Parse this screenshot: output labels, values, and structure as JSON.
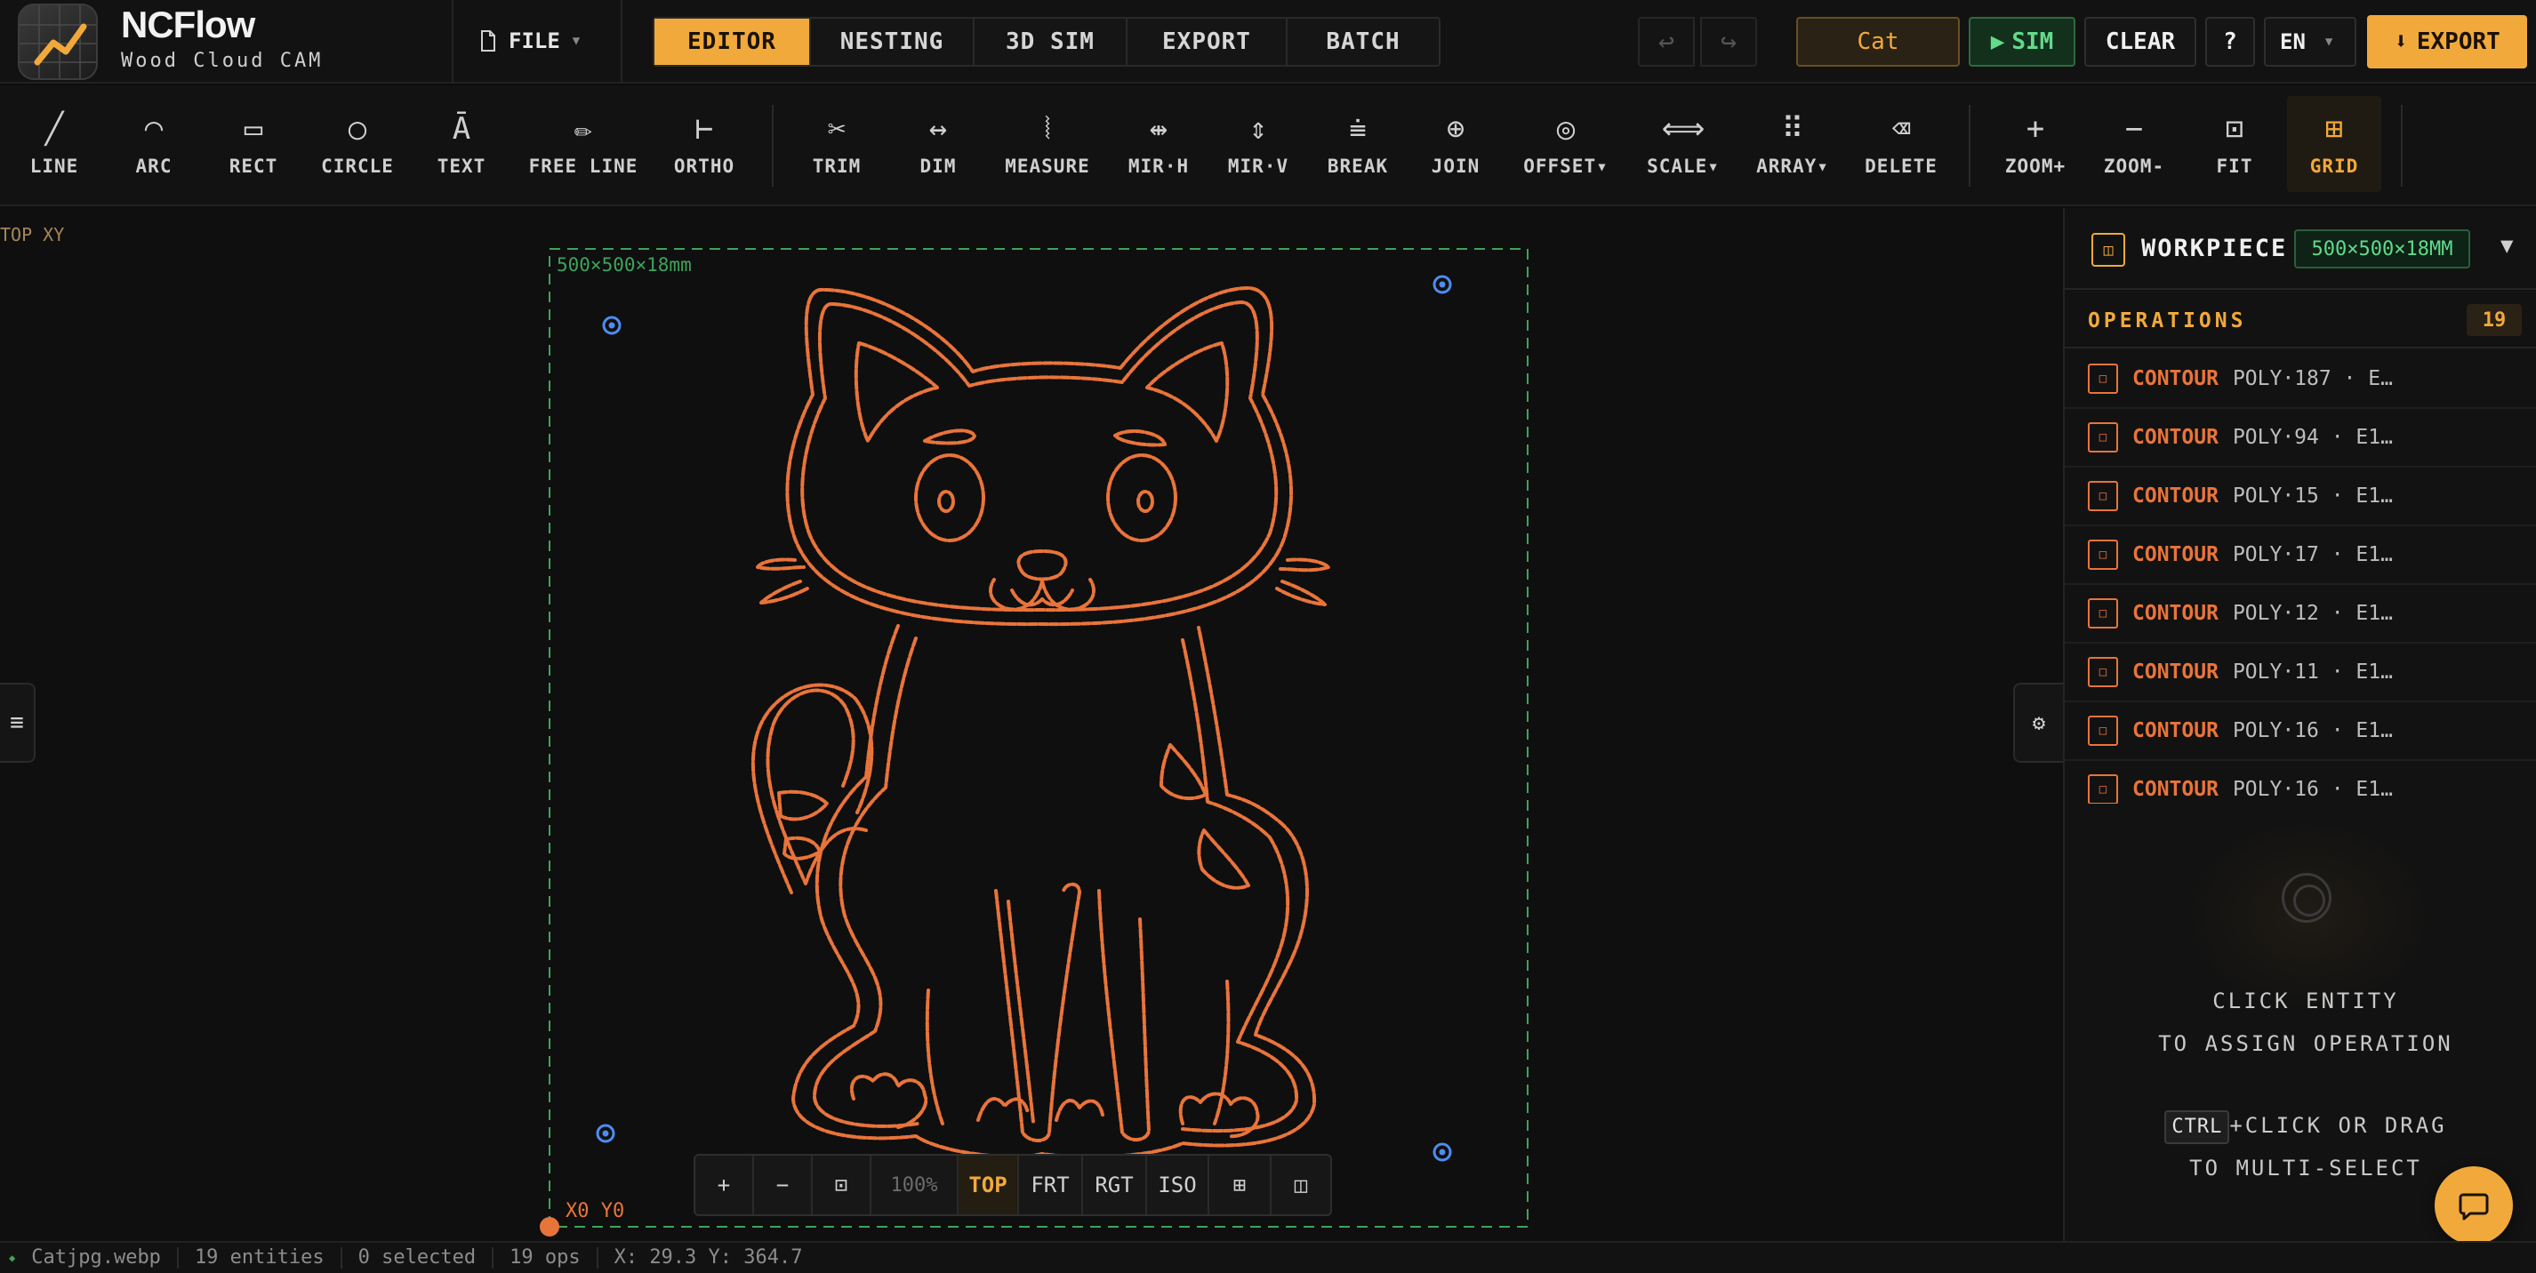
{
  "app": {
    "name": "NCFlow",
    "subtitle": "Wood Cloud CAM"
  },
  "header": {
    "file_menu": "FILE",
    "tabs": [
      {
        "label": "EDITOR",
        "active": true
      },
      {
        "label": "NESTING",
        "active": false
      },
      {
        "label": "3D SIM",
        "active": false
      },
      {
        "label": "EXPORT",
        "active": false
      },
      {
        "label": "BATCH",
        "active": false
      }
    ],
    "undo_icon": "undo-icon",
    "redo_icon": "redo-icon",
    "project_name": "Cat",
    "sim_label": "SIM",
    "clear_label": "CLEAR",
    "help_label": "?",
    "language": "EN",
    "export_label": "EXPORT"
  },
  "toolbar": {
    "tools": [
      {
        "label": "LINE",
        "icon": "╱"
      },
      {
        "label": "ARC",
        "icon": "◠"
      },
      {
        "label": "RECT",
        "icon": "▭"
      },
      {
        "label": "CIRCLE",
        "icon": "○"
      },
      {
        "label": "TEXT",
        "icon": "Ā"
      },
      {
        "label": "FREE LINE",
        "icon": "✏"
      },
      {
        "label": "ORTHO",
        "icon": "⊢"
      },
      {
        "label": "TRIM",
        "icon": "✂"
      },
      {
        "label": "DIM",
        "icon": "↔"
      },
      {
        "label": "MEASURE",
        "icon": "⦚"
      },
      {
        "label": "MIR·H",
        "icon": "⇹"
      },
      {
        "label": "MIR·V",
        "icon": "⇕"
      },
      {
        "label": "BREAK",
        "icon": "⩧"
      },
      {
        "label": "JOIN",
        "icon": "⊕"
      },
      {
        "label": "OFFSET▾",
        "icon": "◎"
      },
      {
        "label": "SCALE▾",
        "icon": "⟺"
      },
      {
        "label": "ARRAY▾",
        "icon": "⠿"
      },
      {
        "label": "DELETE",
        "icon": "⌫"
      },
      {
        "label": "ZOOM+",
        "icon": "+"
      },
      {
        "label": "ZOOM-",
        "icon": "−"
      },
      {
        "label": "FIT",
        "icon": "⊡"
      },
      {
        "label": "GRID",
        "icon": "⊞",
        "active": true
      }
    ]
  },
  "canvas": {
    "view_label": "TOP XY",
    "workpiece_dims": "500×500×18mm",
    "origin_label": "X0 Y0",
    "left_handle_icon": "≡",
    "right_handle_icon": "⚙",
    "viewbar": {
      "zoom_in": "+",
      "zoom_out": "−",
      "fit": "⊡",
      "zoom_level": "100%",
      "views": [
        "TOP",
        "FRT",
        "RGT",
        "ISO"
      ],
      "active_view": "TOP",
      "grid_icon": "⊞",
      "panel_icon": "◫"
    }
  },
  "panel": {
    "workpiece_title": "WORKPIECE",
    "workpiece_badge": "500×500×18MM",
    "workpiece_toggle": "▼",
    "operations_title": "OPERATIONS",
    "operations_count": "19",
    "operations": [
      {
        "type": "CONTOUR",
        "desc": "POLY·187 · E…"
      },
      {
        "type": "CONTOUR",
        "desc": "POLY·94 · E1…"
      },
      {
        "type": "CONTOUR",
        "desc": "POLY·15 · E1…"
      },
      {
        "type": "CONTOUR",
        "desc": "POLY·17 · E1…"
      },
      {
        "type": "CONTOUR",
        "desc": "POLY·12 · E1…"
      },
      {
        "type": "CONTOUR",
        "desc": "POLY·11 · E1…"
      },
      {
        "type": "CONTOUR",
        "desc": "POLY·16 · E1…"
      },
      {
        "type": "CONTOUR",
        "desc": "POLY·16 · E1…"
      }
    ],
    "hint_line1": "CLICK ENTITY",
    "hint_line2": "TO ASSIGN OPERATION",
    "hint_kbd": "CTRL",
    "hint_line3": "+CLICK OR DRAG",
    "hint_line4": "TO MULTI-SELECT"
  },
  "status": {
    "file": "Catjpg.webp",
    "entities": "19 entities",
    "selected": "0 selected",
    "ops": "19 ops",
    "coords": "X: 29.3 Y: 364.7"
  },
  "colors": {
    "accent": "#f2a93b",
    "contour": "#e9743a",
    "workpiece": "#3ea35c",
    "marker": "#4d8df0"
  }
}
